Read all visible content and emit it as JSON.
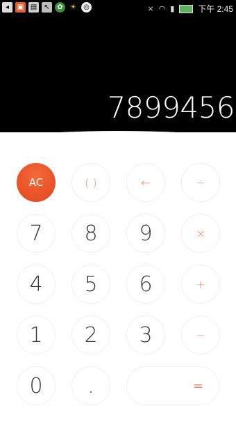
{
  "status_bar": {
    "time": "下午 2:45",
    "icons": [
      "back-icon",
      "notification-icon",
      "image-icon",
      "cursor-icon",
      "leaf-icon",
      "sun-icon",
      "weibo-icon",
      "mute-icon",
      "wifi-icon",
      "signal-icon",
      "battery-icon"
    ]
  },
  "display": {
    "value": "7899456"
  },
  "keys": {
    "ac": "AC",
    "parens": "( )",
    "backspace": "←",
    "divide": "÷",
    "seven": "7",
    "eight": "8",
    "nine": "9",
    "multiply": "×",
    "four": "4",
    "five": "5",
    "six": "6",
    "plus": "+",
    "one": "1",
    "two": "2",
    "three": "3",
    "minus": "−",
    "zero": "0",
    "dot": ".",
    "equals": "="
  },
  "colors": {
    "accent": "#e2441c",
    "operator": "#f0876a",
    "digit": "#3a3a3a",
    "display_bg": "#000000",
    "keypad_bg": "#ffffff"
  }
}
